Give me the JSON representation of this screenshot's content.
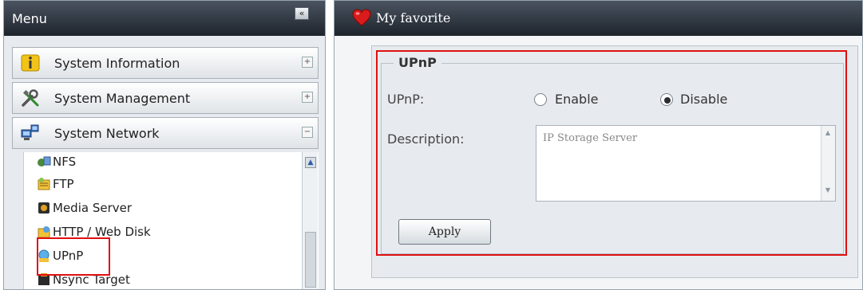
{
  "menu": {
    "title": "Menu",
    "collapse_glyph": "«",
    "categories": [
      {
        "label": "System Information",
        "icon": "info-icon",
        "toggle": "+"
      },
      {
        "label": "System Management",
        "icon": "tools-icon",
        "toggle": "+"
      },
      {
        "label": "System Network",
        "icon": "network-icon",
        "toggle": "−"
      }
    ],
    "network_items": [
      {
        "label": "NFS",
        "icon": "nfs-icon"
      },
      {
        "label": "FTP",
        "icon": "ftp-icon"
      },
      {
        "label": "Media Server",
        "icon": "media-server-icon"
      },
      {
        "label": "HTTP / Web Disk",
        "icon": "web-disk-icon"
      },
      {
        "label": "UPnP",
        "icon": "upnp-icon",
        "selected": true
      },
      {
        "label": "Nsync Target",
        "icon": "nsync-icon"
      }
    ],
    "scroll_up_glyph": "▲"
  },
  "favorite": {
    "title": "My favorite",
    "icon": "heart-icon"
  },
  "upnp_form": {
    "legend": "UPnP",
    "upnp_label": "UPnP:",
    "enable_label": "Enable",
    "disable_label": "Disable",
    "selected": "Disable",
    "description_label": "Description:",
    "description_value": "IP Storage Server",
    "apply_label": "Apply"
  },
  "colors": {
    "header_bg": "#2a313a",
    "highlight_red": "#e01010",
    "panel_bg": "#e7ebef"
  }
}
